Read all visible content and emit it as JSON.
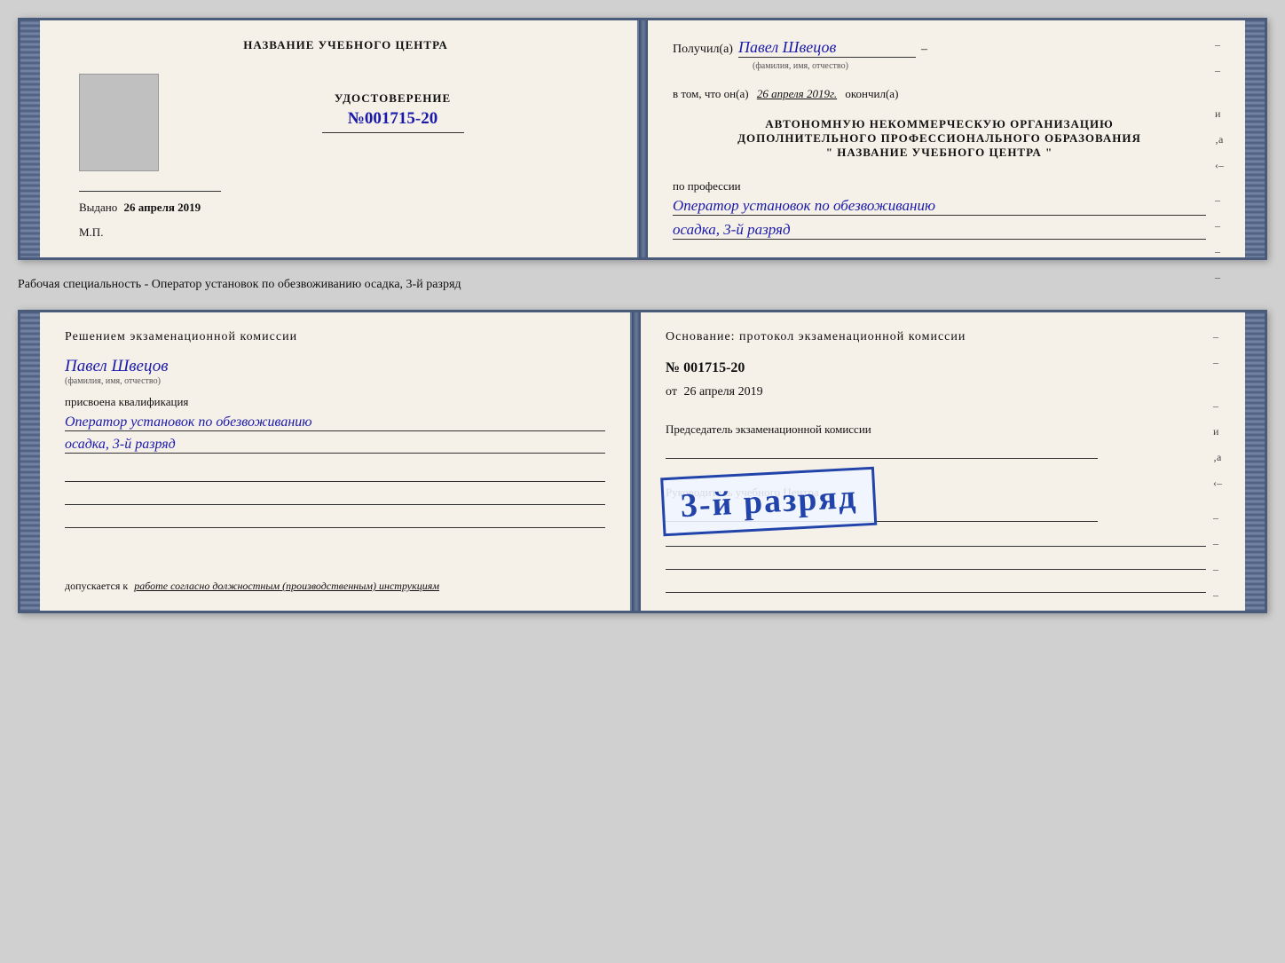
{
  "top_cert": {
    "left": {
      "title": "НАЗВАНИЕ УЧЕБНОГО ЦЕНТРА",
      "cert_label": "УДОСТОВЕРЕНИЕ",
      "cert_number_prefix": "№",
      "cert_number": "001715-20",
      "issued_label": "Выдано",
      "issued_date": "26 апреля 2019",
      "mp_label": "М.П."
    },
    "right": {
      "received_prefix": "Получил(а)",
      "received_name": "Павел Швецов",
      "fio_label": "(фамилия, имя, отчество)",
      "dash": "–",
      "in_that_prefix": "в том, что он(а)",
      "in_that_date": "26 апреля 2019г.",
      "finished": "окончил(а)",
      "org_line1": "АВТОНОМНУЮ НЕКОММЕРЧЕСКУЮ ОРГАНИЗАЦИЮ",
      "org_line2": "ДОПОЛНИТЕЛЬНОГО ПРОФЕССИОНАЛЬНОГО ОБРАЗОВАНИЯ",
      "org_line3": "\"    НАЗВАНИЕ УЧЕБНОГО ЦЕНТРА    \"",
      "profession_label": "по профессии",
      "profession_line1": "Оператор установок по обезвоживанию",
      "profession_line2": "осадка, 3-й разряд"
    }
  },
  "separator": {
    "text": "Рабочая специальность - Оператор установок по обезвоживанию осадка, 3-й разряд"
  },
  "bottom_cert": {
    "left": {
      "title": "Решением экзаменационной комиссии",
      "name": "Павел Швецов",
      "fio_label": "(фамилия, имя, отчество)",
      "assigned_label": "присвоена квалификация",
      "profession_line1": "Оператор установок по обезвоживанию",
      "profession_line2": "осадка, 3-й разряд",
      "допускается_prefix": "допускается к",
      "допускается_text": "работе согласно должностным (производственным) инструкциям"
    },
    "right": {
      "foundation_label": "Основание: протокол экзаменационной комиссии",
      "number_prefix": "№",
      "number": "001715-20",
      "date_prefix": "от",
      "date": "26 апреля 2019",
      "chairman_label": "Председатель экзаменационной комиссии",
      "director_label": "Руководитель учебного Центра"
    },
    "stamp": {
      "text": "3-й разряд"
    }
  }
}
